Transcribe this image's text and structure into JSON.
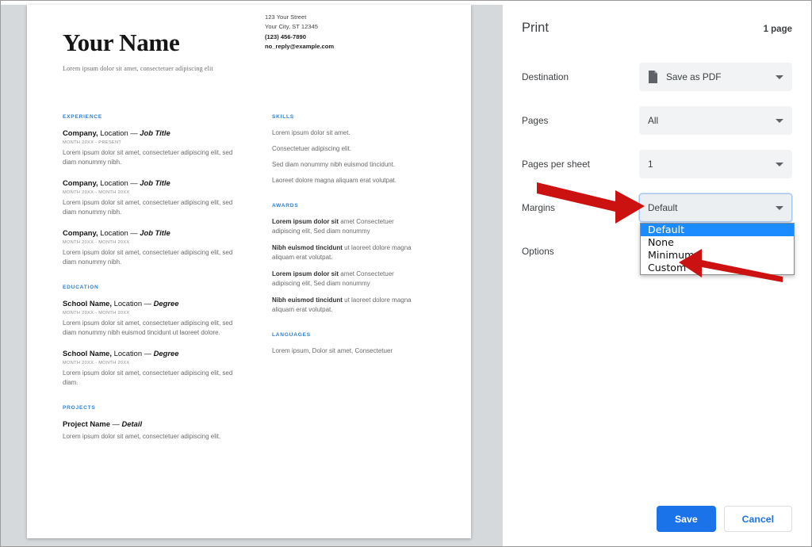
{
  "resume": {
    "name": "Your Name",
    "tagline": "Lorem ipsum dolor sit amet, consectetuer adipiscing elit",
    "contact": {
      "street": "123 Your Street",
      "city": "Your City, ST 12345",
      "phone": "(123) 456-7890",
      "email": "no_reply@example.com"
    },
    "sections": {
      "experience_heading": "EXPERIENCE",
      "education_heading": "EDUCATION",
      "projects_heading": "PROJECTS",
      "skills_heading": "SKILLS",
      "awards_heading": "AWARDS",
      "languages_heading": "LANGUAGES"
    },
    "experience": [
      {
        "company": "Company,",
        "location": "Location",
        "dash": "—",
        "title": "Job Title",
        "date": "MONTH 20XX - PRESENT",
        "desc": "Lorem ipsum dolor sit amet, consectetuer adipiscing elit, sed diam nonummy nibh."
      },
      {
        "company": "Company,",
        "location": "Location",
        "dash": "—",
        "title": "Job Title",
        "date": "MONTH 20XX - MONTH 20XX",
        "desc": "Lorem ipsum dolor sit amet, consectetuer adipiscing elit, sed diam nonummy nibh."
      },
      {
        "company": "Company,",
        "location": "Location",
        "dash": "—",
        "title": "Job Title",
        "date": "MONTH 20XX - MONTH 20XX",
        "desc": "Lorem ipsum dolor sit amet, consectetuer adipiscing elit, sed diam nonummy nibh."
      }
    ],
    "education": [
      {
        "school": "School Name,",
        "location": "Location",
        "dash": "—",
        "degree": "Degree",
        "date": "MONTH 20XX - MONTH 20XX",
        "desc": "Lorem ipsum dolor sit amet, consectetuer adipiscing elit, sed diam nonummy nibh euismod tincidunt ut laoreet dolore."
      },
      {
        "school": "School Name,",
        "location": "Location",
        "dash": "—",
        "degree": "Degree",
        "date": "MONTH 20XX - MONTH 20XX",
        "desc": "Lorem ipsum dolor sit amet, consectetuer adipiscing elit, sed diam."
      }
    ],
    "projects": [
      {
        "project": "Project Name",
        "dash": "—",
        "detail": "Detail",
        "desc": "Lorem ipsum dolor sit amet, consectetuer adipiscing elit."
      }
    ],
    "skills": [
      "Lorem ipsum dolor sit amet.",
      "Consectetuer adipiscing elit.",
      "Sed diam nonummy nibh euismod tincidunt.",
      "Laoreet dolore magna aliquam erat volutpat."
    ],
    "awards": [
      {
        "bold": "Lorem ipsum dolor sit",
        "rest": " amet Consectetuer adipiscing elit, Sed diam nonummy"
      },
      {
        "bold": "Nibh euismod tincidunt",
        "rest": " ut laoreet dolore magna aliquam erat volutpat."
      },
      {
        "bold": "Lorem ipsum dolor sit",
        "rest": " amet Consectetuer adipiscing elit, Sed diam nonummy"
      },
      {
        "bold": "Nibh euismod tincidunt",
        "rest": " ut laoreet dolore magna aliquam erat volutpat."
      }
    ],
    "languages": [
      "Lorem ipsum, Dolor sit amet, Consectetuer"
    ]
  },
  "print_dialog": {
    "title": "Print",
    "page_count": "1 page",
    "rows": {
      "destination": {
        "label": "Destination",
        "value": "Save as PDF",
        "icon": "document-icon"
      },
      "pages": {
        "label": "Pages",
        "value": "All"
      },
      "pages_per_sheet": {
        "label": "Pages per sheet",
        "value": "1"
      },
      "margins": {
        "label": "Margins",
        "value": "Default"
      },
      "options": {
        "label": "Options"
      }
    },
    "margins_options": [
      {
        "label": "Default",
        "selected": true
      },
      {
        "label": "None",
        "selected": false
      },
      {
        "label": "Minimum",
        "selected": false
      },
      {
        "label": "Custom",
        "selected": false
      }
    ],
    "buttons": {
      "save": "Save",
      "cancel": "Cancel"
    },
    "colors": {
      "accent": "#1a73e8",
      "highlight": "#1a8cff",
      "select_bg": "#f1f3f4",
      "annotation_arrow": "#cc1111"
    }
  }
}
